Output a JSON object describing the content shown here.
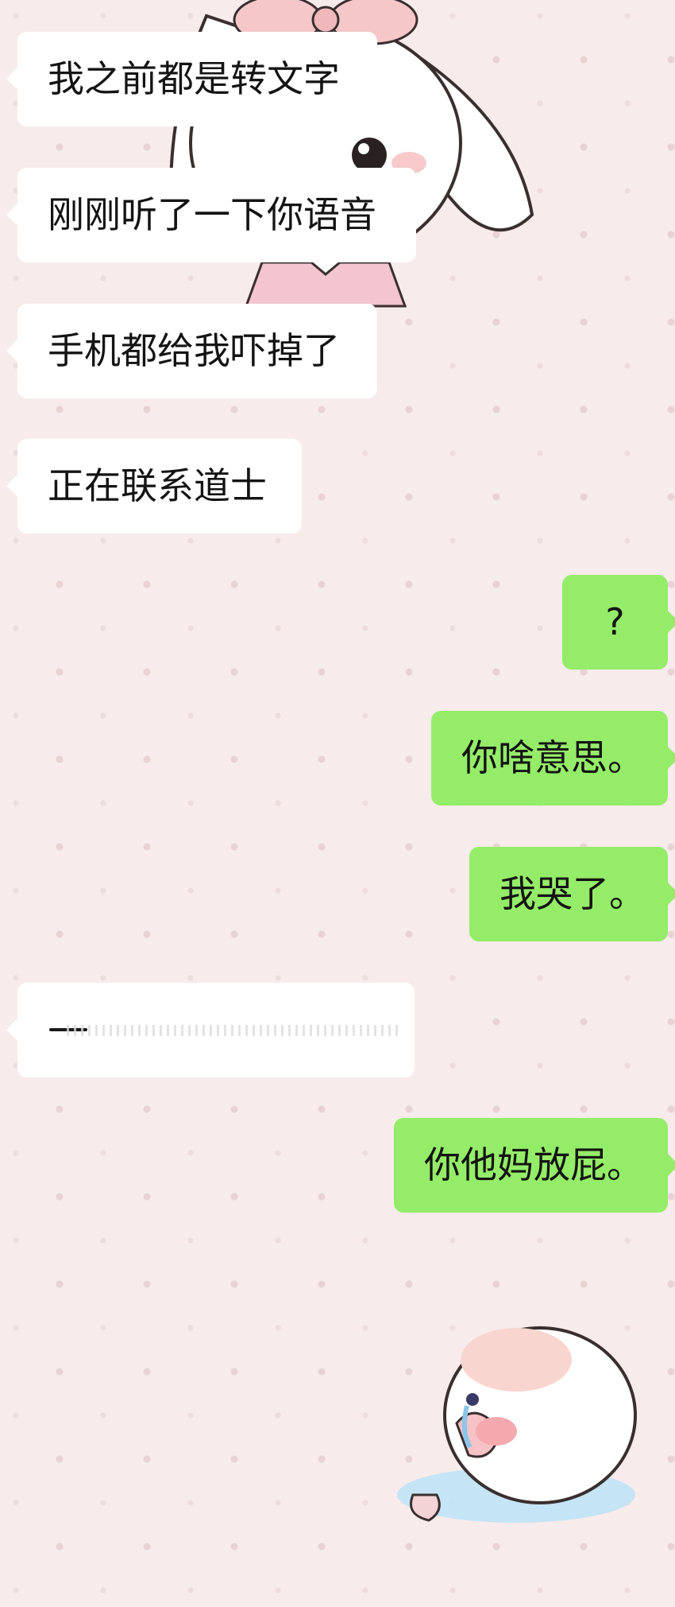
{
  "chat": {
    "messages": [
      {
        "side": "in",
        "text": "我之前都是转文字"
      },
      {
        "side": "in",
        "text": "刚刚听了一下你语音"
      },
      {
        "side": "in",
        "text": "手机都给我吓掉了"
      },
      {
        "side": "in",
        "text": "正在联系道士"
      },
      {
        "side": "out",
        "text": "?"
      },
      {
        "side": "out",
        "text": "你啥意思。"
      },
      {
        "side": "out",
        "text": "我哭了。"
      },
      {
        "side": "in",
        "text": "",
        "type": "redacted-message"
      },
      {
        "side": "out",
        "text": "你他妈放屁。"
      }
    ]
  },
  "colors": {
    "background": "#f8ebeb",
    "incoming_bubble": "#ffffff",
    "outgoing_bubble": "#95ec69"
  },
  "decorations": {
    "top_sticker": "bunny-girl-sticker",
    "bottom_sticker": "crying-bunny-sticker"
  }
}
